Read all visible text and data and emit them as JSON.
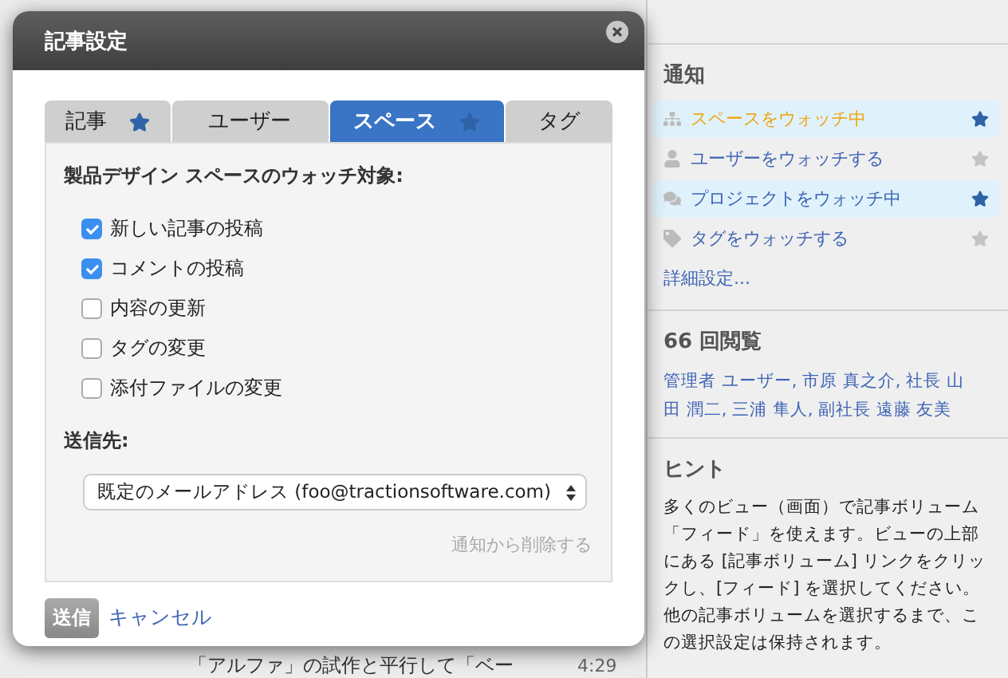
{
  "dialog": {
    "title": "記事設定",
    "tabs": [
      {
        "label": "記事",
        "starred": true,
        "selected": false
      },
      {
        "label": "ユーザー",
        "starred": false,
        "selected": false
      },
      {
        "label": "スペース",
        "starred": true,
        "selected": true
      },
      {
        "label": "タグ",
        "starred": false,
        "selected": false
      }
    ],
    "heading": "製品デザイン スペースのウォッチ対象:",
    "options": [
      {
        "label": "新しい記事の投稿",
        "checked": true
      },
      {
        "label": "コメントの投稿",
        "checked": true
      },
      {
        "label": "内容の更新",
        "checked": false
      },
      {
        "label": "タグの変更",
        "checked": false
      },
      {
        "label": "添付ファイルの変更",
        "checked": false
      }
    ],
    "send_to_label": "送信先:",
    "send_to_value": "既定のメールアドレス (foo@tractionsoftware.com)",
    "remove_link": "通知から削除する",
    "submit": "送信",
    "cancel": "キャンセル"
  },
  "background": {
    "snippet": "「アルファ」の試作と平行して「ベー",
    "time": "4:29"
  },
  "sidebar": {
    "notifications": {
      "title": "通知",
      "items": [
        {
          "kind": "space",
          "label": "スペースをウォッチ中",
          "watching": true,
          "hovered": true
        },
        {
          "kind": "user",
          "label": "ユーザーをウォッチする",
          "watching": false,
          "hovered": false
        },
        {
          "kind": "project",
          "label": "プロジェクトをウォッチ中",
          "watching": true,
          "hovered": false
        },
        {
          "kind": "tag",
          "label": "タグをウォッチする",
          "watching": false,
          "hovered": false
        }
      ],
      "more_link": "詳細設定..."
    },
    "views": {
      "title": "66 回閲覧",
      "viewers": "管理者 ユーザー, 市原 真之介, 社長 山田 潤二, 三浦 隼人, 副社長 遠藤 友美"
    },
    "hint": {
      "title": "ヒント",
      "text": "多くのビュー（画面）で記事ボリューム「フィード」を使えます。ビューの上部にある [記事ボリューム] リンクをクリックし、[フィード] を選択してください。他の記事ボリュームを選択するまで、この選択設定は保持されます。"
    }
  }
}
